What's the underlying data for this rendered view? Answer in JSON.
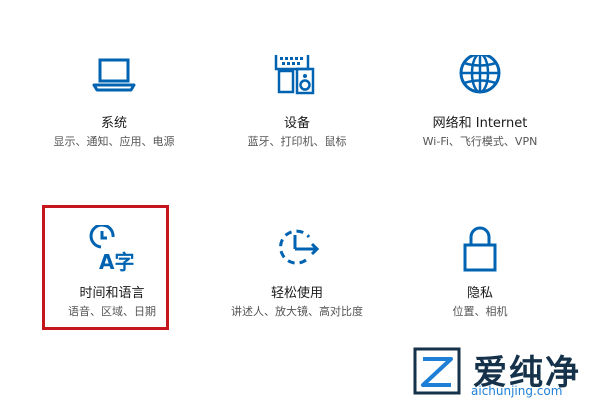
{
  "colors": {
    "accent": "#0063b1",
    "highlight_border": "#c4161c",
    "brand_dark": "#16324a",
    "brand_blue": "#1e7fd6"
  },
  "tiles": [
    {
      "icon": "laptop-icon",
      "title": "系统",
      "desc": "显示、通知、应用、电源"
    },
    {
      "icon": "keyboard-speaker-icon",
      "title": "设备",
      "desc": "蓝牙、打印机、鼠标"
    },
    {
      "icon": "globe-icon",
      "title": "网络和 Internet",
      "desc": "Wi-Fi、飞行模式、VPN"
    },
    {
      "icon": "time-language-icon",
      "title": "时间和语言",
      "desc": "语音、区域、日期"
    },
    {
      "icon": "ease-of-access-icon",
      "title": "轻松使用",
      "desc": "讲述人、放大镜、高对比度"
    },
    {
      "icon": "lock-icon",
      "title": "隐私",
      "desc": "位置、相机"
    }
  ],
  "time_icon_glyph": "A字",
  "watermark": {
    "name": "爱纯净",
    "url": "aichunjing.com"
  }
}
